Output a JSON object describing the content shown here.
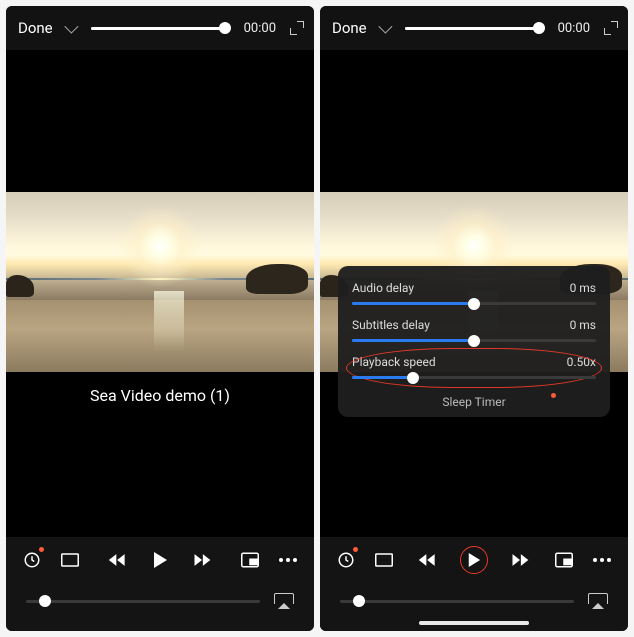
{
  "top": {
    "done": "Done",
    "time": "00:00"
  },
  "left": {
    "title": "Sea Video demo (1)"
  },
  "panel": {
    "audio_delay_label": "Audio delay",
    "audio_delay_value": "0 ms",
    "audio_delay_pct": 50,
    "subtitles_delay_label": "Subtitles delay",
    "subtitles_delay_value": "0 ms",
    "subtitles_delay_pct": 50,
    "playback_speed_label": "Playback speed",
    "playback_speed_value": "0.50x",
    "playback_speed_pct": 25,
    "sleep_timer": "Sleep Timer"
  },
  "icons": {
    "clock": "clock",
    "aspect": "aspect",
    "skip_back": "skip-back",
    "play": "play",
    "skip_fwd": "skip-fwd",
    "pip": "pip",
    "more": "more",
    "airplay": "airplay"
  }
}
